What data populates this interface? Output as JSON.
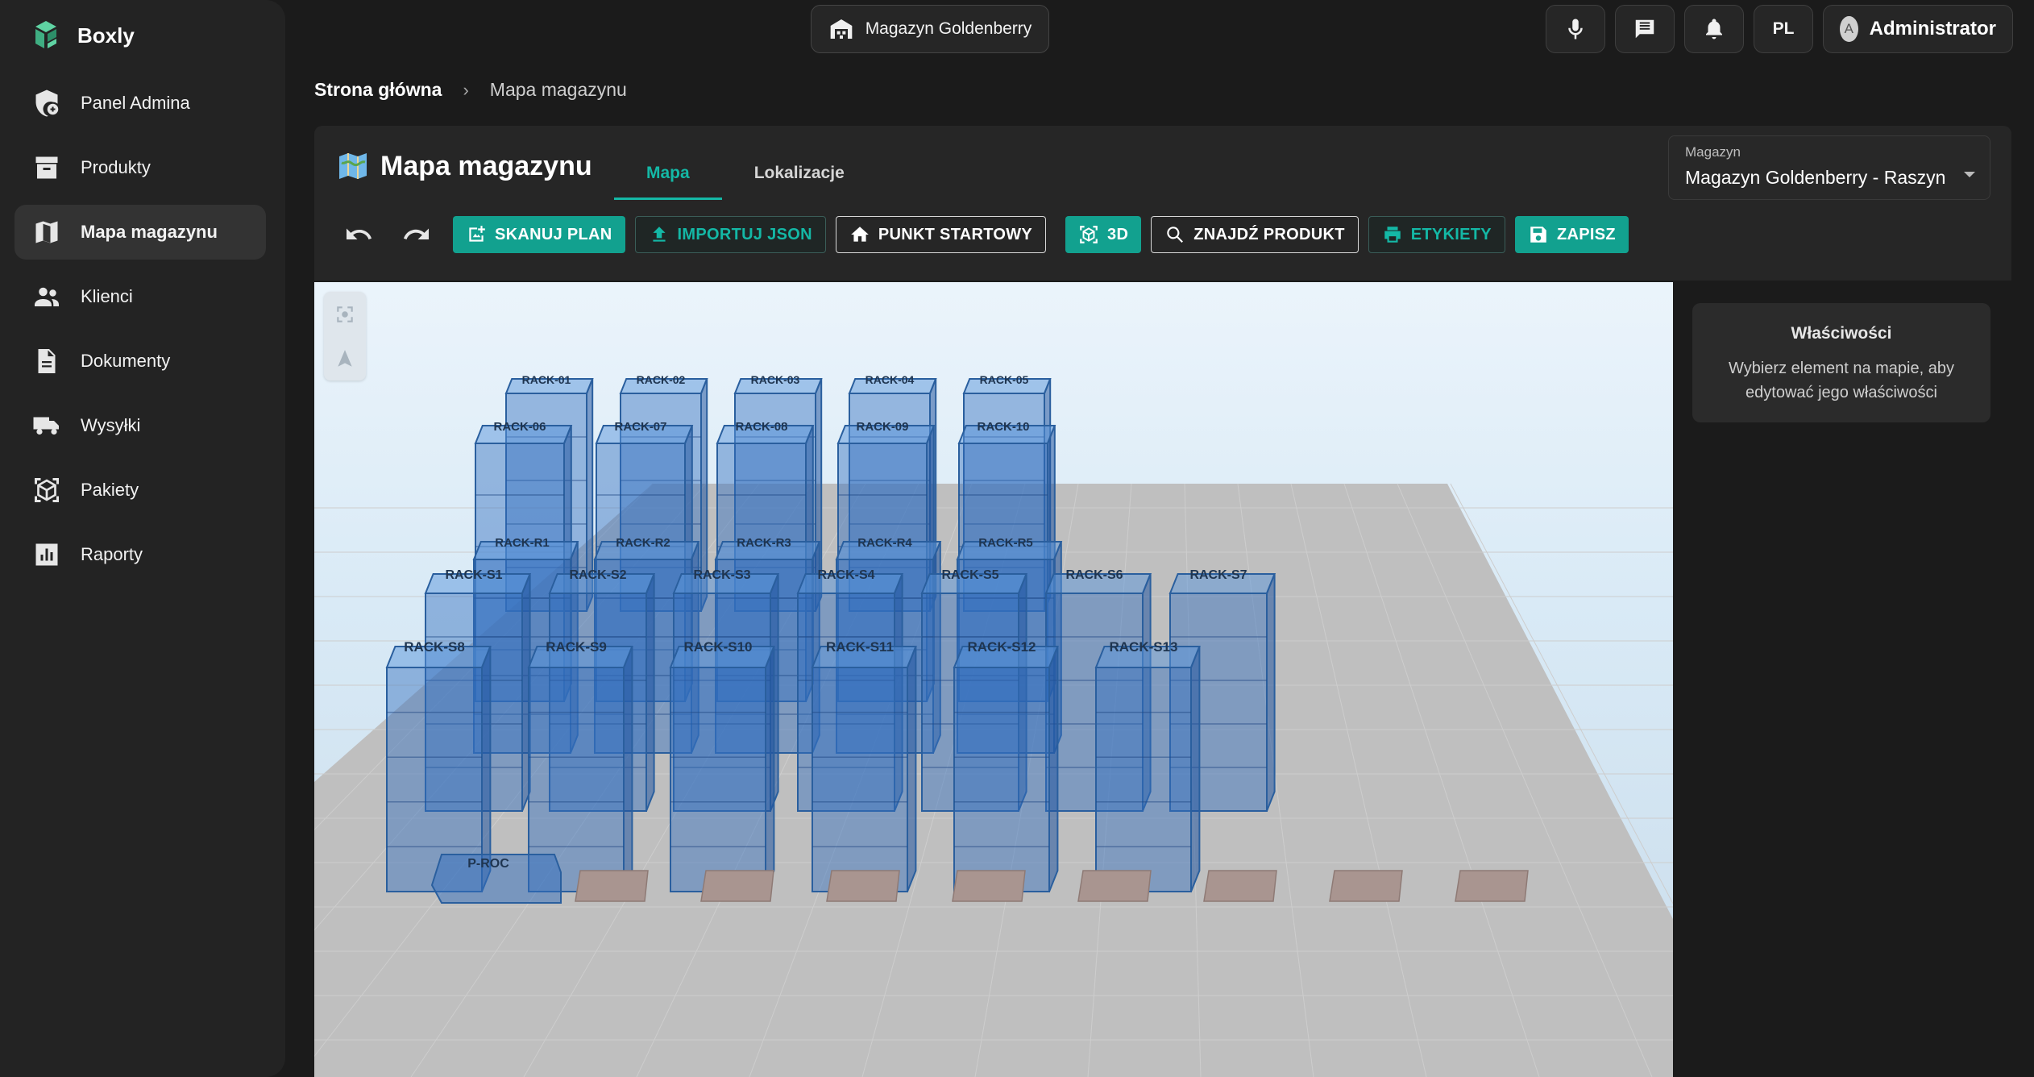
{
  "app": {
    "name": "Boxly"
  },
  "sidebar": {
    "items": [
      {
        "label": "Panel Admina",
        "icon": "admin-shield-icon",
        "active": false
      },
      {
        "label": "Produkty",
        "icon": "archive-box-icon",
        "active": false
      },
      {
        "label": "Mapa magazynu",
        "icon": "map-icon",
        "active": true
      },
      {
        "label": "Klienci",
        "icon": "people-icon",
        "active": false
      },
      {
        "label": "Dokumenty",
        "icon": "document-icon",
        "active": false
      },
      {
        "label": "Wysyłki",
        "icon": "truck-icon",
        "active": false
      },
      {
        "label": "Pakiety",
        "icon": "package-icon",
        "active": false
      },
      {
        "label": "Raporty",
        "icon": "bar-chart-icon",
        "active": false
      }
    ]
  },
  "header": {
    "warehouse": "Magazyn Goldenberry",
    "language": "PL",
    "user": {
      "initial": "A",
      "name": "Administrator"
    }
  },
  "breadcrumb": {
    "home": "Strona główna",
    "separator": "›",
    "current": "Mapa magazynu"
  },
  "page": {
    "title": "Mapa magazynu",
    "tabs": [
      {
        "label": "Mapa",
        "active": true
      },
      {
        "label": "Lokalizacje",
        "active": false
      }
    ],
    "warehouse_select": {
      "label": "Magazyn",
      "value": "Magazyn Goldenberry - Raszyn"
    }
  },
  "toolbar": {
    "scan_plan": "SKANUJ PLAN",
    "import_json": "IMPORTUJ JSON",
    "start_point": "PUNKT STARTOWY",
    "view_3d": "3D",
    "find_product": "ZNAJDŹ PRODUKT",
    "labels": "ETYKIETY",
    "save": "ZAPISZ"
  },
  "colors": {
    "accent": "#12a18f",
    "rack": "#3b78c0",
    "floor": "#bdbdbd"
  },
  "map": {
    "racks_back": [
      "RACK-01",
      "RACK-02",
      "RACK-03",
      "RACK-04",
      "RACK-05"
    ],
    "racks_second": [
      "RACK-06",
      "RACK-07",
      "RACK-08",
      "RACK-09",
      "RACK-10"
    ],
    "racks_mid": [
      "RACK-R1",
      "RACK-R2",
      "RACK-R3",
      "RACK-R4",
      "RACK-R5"
    ],
    "racks_s_row": [
      "RACK-S1",
      "RACK-S2",
      "RACK-S3",
      "RACK-S4",
      "RACK-S5",
      "RACK-S6",
      "RACK-S7"
    ],
    "racks_front": [
      "RACK-S8",
      "RACK-S9",
      "RACK-S10",
      "RACK-S11",
      "RACK-S12",
      "RACK-S13"
    ],
    "zones": [
      "P-ROC"
    ]
  },
  "properties": {
    "title": "Właściwości",
    "hint": "Wybierz element na mapie, aby edytować jego właściwości"
  }
}
